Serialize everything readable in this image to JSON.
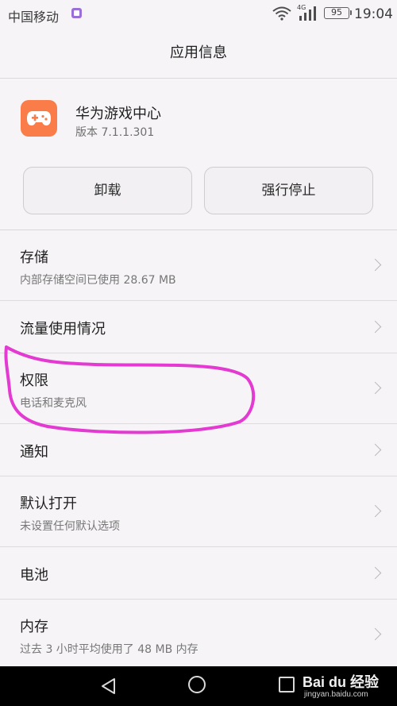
{
  "status_bar": {
    "carrier": "中国移动",
    "network": "4G",
    "battery": "95",
    "time": "19:04"
  },
  "header": {
    "title": "应用信息"
  },
  "app": {
    "name": "华为游戏中心",
    "version": "版本 7.1.1.301",
    "icon": "gamepad-icon",
    "icon_color": "#fa7c48"
  },
  "actions": {
    "uninstall_label": "卸载",
    "force_stop_label": "强行停止"
  },
  "items": [
    {
      "title": "存储",
      "subtitle": "内部存储空间已使用 28.67 MB"
    },
    {
      "title": "流量使用情况",
      "subtitle": ""
    },
    {
      "title": "权限",
      "subtitle": "电话和麦克风"
    },
    {
      "title": "通知",
      "subtitle": ""
    },
    {
      "title": "默认打开",
      "subtitle": "未设置任何默认选项"
    },
    {
      "title": "电池",
      "subtitle": ""
    },
    {
      "title": "内存",
      "subtitle": "过去 3 小时平均使用了 48 MB 内存"
    }
  ],
  "annotation": {
    "color": "#e33ad2",
    "shape": "hand-drawn-ellipse"
  },
  "watermark": {
    "logo": "Bai du 经验",
    "url": "jingyan.baidu.com"
  },
  "colors": {
    "background": "#f6f4f7",
    "nav_bar": "#000000"
  }
}
